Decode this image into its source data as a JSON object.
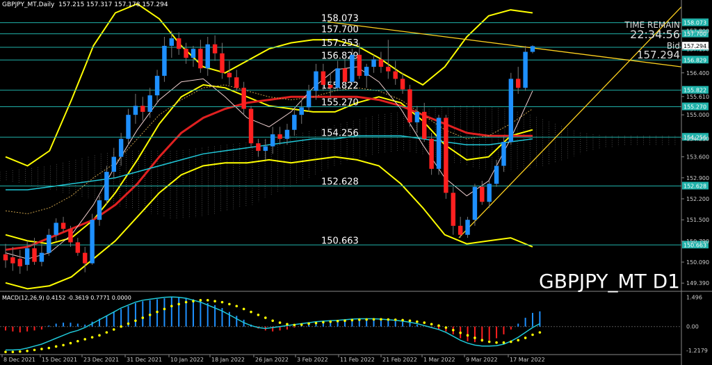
{
  "header": {
    "symbol_tf": "GBPJPY_MT,Daily",
    "ohlc": "157.215 157.317 157.178 157.294"
  },
  "watermark": "GBPJPY_MT D1",
  "info_box": {
    "time_remain_label": "TIME REMAIN",
    "time_remain_value": "22:34:56",
    "bid_label": "Bid",
    "bid_value": "157.294"
  },
  "macd_label": "MACD(12,26,9) 0.4152 -0.3619 0.7771 0.0000",
  "colors": {
    "bg": "#000000",
    "bull": "#1e90ff",
    "bear": "#ff2020",
    "level_line": "#20b2aa",
    "yellow": "#ffff00",
    "red_ma": "#e02020",
    "cyan_ma": "#20c8d8",
    "pink_ma": "#f0d0d0",
    "trend": "#ffd21f"
  },
  "chart_data": {
    "type": "candlestick",
    "title": "GBPJPY_MT D1",
    "ylim": [
      149.14,
      158.55
    ],
    "y_ticks": [
      "157.800",
      "157.190",
      "156.400",
      "155.610",
      "155.000",
      "154.210",
      "153.600",
      "152.900",
      "152.200",
      "151.500",
      "150.790",
      "150.090",
      "149.390"
    ],
    "x_labels": [
      "8 Dec 2021",
      "15 Dec 2021",
      "23 Dec 2021",
      "31 Dec 2021",
      "10 Jan 2022",
      "18 Jan 2022",
      "26 Jan 2022",
      "3 Feb 2022",
      "11 Feb 2022",
      "21 Feb 2022",
      "1 Mar 2022",
      "9 Mar 2022",
      "17 Mar 2022"
    ],
    "levels": [
      {
        "value": 158.073,
        "label": "158.073",
        "tag": "158.073"
      },
      {
        "value": 157.7,
        "label": "157.700",
        "tag": "157.700"
      },
      {
        "value": 157.253,
        "label": "157.253",
        "tag": "157.253"
      },
      {
        "value": 156.829,
        "label": "156.829",
        "tag": "156.829"
      },
      {
        "value": 155.822,
        "label": "155.822",
        "tag": "155.822"
      },
      {
        "value": 155.27,
        "label": "155.270",
        "tag": "155.270"
      },
      {
        "value": 154.256,
        "label": "154.256",
        "tag": "154.256"
      },
      {
        "value": 152.628,
        "label": "152.628",
        "tag": "152.628"
      },
      {
        "value": 150.663,
        "label": "150.663",
        "tag": "150.663"
      }
    ],
    "current_price": {
      "value": 157.294,
      "tag": "157.294"
    },
    "candles": [
      {
        "o": 150.35,
        "h": 150.7,
        "l": 149.9,
        "c": 150.15
      },
      {
        "o": 150.25,
        "h": 150.6,
        "l": 149.8,
        "c": 150.05
      },
      {
        "o": 150.2,
        "h": 150.5,
        "l": 149.7,
        "c": 149.95
      },
      {
        "o": 150.0,
        "h": 150.8,
        "l": 149.8,
        "c": 150.55
      },
      {
        "o": 150.55,
        "h": 150.9,
        "l": 150.0,
        "c": 150.1
      },
      {
        "o": 150.1,
        "h": 150.7,
        "l": 149.95,
        "c": 150.4
      },
      {
        "o": 150.4,
        "h": 151.2,
        "l": 150.3,
        "c": 151.0
      },
      {
        "o": 151.0,
        "h": 151.55,
        "l": 150.8,
        "c": 151.4
      },
      {
        "o": 151.4,
        "h": 151.6,
        "l": 151.1,
        "c": 151.2
      },
      {
        "o": 151.2,
        "h": 151.3,
        "l": 150.6,
        "c": 150.75
      },
      {
        "o": 150.75,
        "h": 150.9,
        "l": 150.3,
        "c": 150.4
      },
      {
        "o": 150.4,
        "h": 150.6,
        "l": 149.75,
        "c": 150.05
      },
      {
        "o": 150.05,
        "h": 151.7,
        "l": 150.0,
        "c": 151.5
      },
      {
        "o": 151.5,
        "h": 152.3,
        "l": 151.3,
        "c": 152.15
      },
      {
        "o": 152.15,
        "h": 153.3,
        "l": 152.0,
        "c": 153.1
      },
      {
        "o": 153.1,
        "h": 153.9,
        "l": 152.9,
        "c": 153.6
      },
      {
        "o": 153.6,
        "h": 154.4,
        "l": 153.3,
        "c": 154.2
      },
      {
        "o": 154.2,
        "h": 155.2,
        "l": 154.0,
        "c": 155.0
      },
      {
        "o": 155.0,
        "h": 155.7,
        "l": 154.7,
        "c": 155.3
      },
      {
        "o": 155.3,
        "h": 155.6,
        "l": 154.8,
        "c": 155.1
      },
      {
        "o": 155.1,
        "h": 155.9,
        "l": 154.9,
        "c": 155.65
      },
      {
        "o": 155.65,
        "h": 156.5,
        "l": 155.4,
        "c": 156.3
      },
      {
        "o": 156.3,
        "h": 157.6,
        "l": 156.1,
        "c": 157.3
      },
      {
        "o": 157.3,
        "h": 157.8,
        "l": 156.9,
        "c": 157.55
      },
      {
        "o": 157.55,
        "h": 157.75,
        "l": 157.0,
        "c": 157.2
      },
      {
        "o": 157.2,
        "h": 157.4,
        "l": 156.7,
        "c": 156.9
      },
      {
        "o": 156.9,
        "h": 157.3,
        "l": 156.6,
        "c": 157.2
      },
      {
        "o": 157.2,
        "h": 157.5,
        "l": 156.4,
        "c": 156.55
      },
      {
        "o": 156.55,
        "h": 157.6,
        "l": 156.3,
        "c": 157.35
      },
      {
        "o": 157.35,
        "h": 157.65,
        "l": 156.8,
        "c": 157.05
      },
      {
        "o": 157.05,
        "h": 157.4,
        "l": 156.2,
        "c": 156.4
      },
      {
        "o": 156.4,
        "h": 156.8,
        "l": 156.0,
        "c": 156.25
      },
      {
        "o": 156.25,
        "h": 156.5,
        "l": 155.8,
        "c": 155.9
      },
      {
        "o": 155.9,
        "h": 156.1,
        "l": 155.0,
        "c": 155.2
      },
      {
        "o": 155.2,
        "h": 155.3,
        "l": 153.9,
        "c": 154.05
      },
      {
        "o": 154.05,
        "h": 154.2,
        "l": 153.6,
        "c": 153.8
      },
      {
        "o": 153.8,
        "h": 154.2,
        "l": 153.5,
        "c": 153.95
      },
      {
        "o": 153.95,
        "h": 154.6,
        "l": 153.7,
        "c": 154.35
      },
      {
        "o": 154.35,
        "h": 154.6,
        "l": 154.0,
        "c": 154.2
      },
      {
        "o": 154.2,
        "h": 154.7,
        "l": 154.0,
        "c": 154.5
      },
      {
        "o": 154.5,
        "h": 155.2,
        "l": 154.3,
        "c": 155.0
      },
      {
        "o": 155.0,
        "h": 155.5,
        "l": 154.7,
        "c": 155.25
      },
      {
        "o": 155.25,
        "h": 156.0,
        "l": 155.1,
        "c": 155.8
      },
      {
        "o": 155.8,
        "h": 156.7,
        "l": 155.5,
        "c": 156.45
      },
      {
        "o": 156.45,
        "h": 156.7,
        "l": 155.8,
        "c": 156.0
      },
      {
        "o": 156.0,
        "h": 156.4,
        "l": 155.6,
        "c": 155.9
      },
      {
        "o": 155.9,
        "h": 156.8,
        "l": 155.8,
        "c": 156.55
      },
      {
        "o": 156.55,
        "h": 156.9,
        "l": 155.9,
        "c": 156.1
      },
      {
        "o": 156.1,
        "h": 157.2,
        "l": 156.0,
        "c": 157.0
      },
      {
        "o": 157.0,
        "h": 157.4,
        "l": 156.2,
        "c": 156.3
      },
      {
        "o": 156.3,
        "h": 156.7,
        "l": 155.9,
        "c": 156.6
      },
      {
        "o": 156.6,
        "h": 157.0,
        "l": 156.4,
        "c": 156.85
      },
      {
        "o": 156.85,
        "h": 157.1,
        "l": 156.4,
        "c": 156.6
      },
      {
        "o": 156.6,
        "h": 157.5,
        "l": 156.2,
        "c": 156.45
      },
      {
        "o": 156.45,
        "h": 156.8,
        "l": 156.0,
        "c": 156.2
      },
      {
        "o": 156.2,
        "h": 156.4,
        "l": 155.7,
        "c": 155.85
      },
      {
        "o": 155.85,
        "h": 156.0,
        "l": 154.6,
        "c": 154.75
      },
      {
        "o": 154.75,
        "h": 155.3,
        "l": 154.4,
        "c": 155.1
      },
      {
        "o": 155.1,
        "h": 155.4,
        "l": 154.1,
        "c": 154.2
      },
      {
        "o": 154.2,
        "h": 154.4,
        "l": 153.0,
        "c": 153.2
      },
      {
        "o": 153.2,
        "h": 155.0,
        "l": 153.0,
        "c": 154.9
      },
      {
        "o": 154.9,
        "h": 155.0,
        "l": 152.2,
        "c": 152.4
      },
      {
        "o": 152.4,
        "h": 152.6,
        "l": 151.0,
        "c": 151.3
      },
      {
        "o": 151.3,
        "h": 151.6,
        "l": 150.9,
        "c": 151.0
      },
      {
        "o": 151.0,
        "h": 151.6,
        "l": 150.9,
        "c": 151.5
      },
      {
        "o": 151.5,
        "h": 152.7,
        "l": 151.3,
        "c": 152.6
      },
      {
        "o": 152.6,
        "h": 152.8,
        "l": 152.0,
        "c": 152.1
      },
      {
        "o": 152.1,
        "h": 152.8,
        "l": 151.9,
        "c": 152.7
      },
      {
        "o": 152.7,
        "h": 153.5,
        "l": 152.6,
        "c": 153.3
      },
      {
        "o": 153.3,
        "h": 154.3,
        "l": 153.1,
        "c": 154.1
      },
      {
        "o": 154.1,
        "h": 156.4,
        "l": 154.0,
        "c": 156.2
      },
      {
        "o": 156.2,
        "h": 156.6,
        "l": 155.7,
        "c": 155.9
      },
      {
        "o": 155.9,
        "h": 157.3,
        "l": 155.8,
        "c": 157.1
      },
      {
        "o": 157.1,
        "h": 157.32,
        "l": 157.05,
        "c": 157.29
      }
    ],
    "macd": {
      "ylim": [
        -1.4,
        1.7
      ],
      "ticks": [
        "1.496",
        "0.00",
        "-1.2179"
      ],
      "histogram": [
        -0.2,
        -0.25,
        -0.3,
        -0.25,
        -0.2,
        -0.15,
        0.05,
        0.15,
        0.2,
        0.2,
        0.15,
        0.1,
        0.25,
        0.4,
        0.55,
        0.75,
        0.9,
        1.05,
        1.2,
        1.3,
        1.35,
        1.4,
        1.45,
        1.5,
        1.5,
        1.45,
        1.4,
        1.3,
        1.2,
        1.1,
        0.95,
        0.75,
        0.55,
        0.35,
        0.1,
        -0.1,
        -0.2,
        -0.25,
        -0.2,
        -0.15,
        -0.05,
        0.05,
        0.15,
        0.2,
        0.22,
        0.25,
        0.3,
        0.32,
        0.35,
        0.35,
        0.35,
        0.33,
        0.3,
        0.3,
        0.28,
        0.25,
        0.2,
        0.1,
        0.0,
        -0.05,
        -0.15,
        -0.25,
        -0.4,
        -0.6,
        -0.75,
        -0.8,
        -0.78,
        -0.7,
        -0.6,
        -0.4,
        -0.15,
        0.15,
        0.45,
        0.7,
        0.78
      ],
      "macd_line": [
        -1.2,
        -1.2,
        -1.18,
        -1.1,
        -1.0,
        -0.9,
        -0.75,
        -0.6,
        -0.45,
        -0.3,
        -0.2,
        -0.05,
        0.15,
        0.35,
        0.55,
        0.75,
        0.95,
        1.1,
        1.25,
        1.35,
        1.4,
        1.45,
        1.5,
        1.52,
        1.5,
        1.45,
        1.35,
        1.25,
        1.1,
        0.95,
        0.8,
        0.6,
        0.4,
        0.2,
        0.05,
        -0.05,
        -0.1,
        -0.05,
        0.0,
        0.05,
        0.1,
        0.15,
        0.2,
        0.25,
        0.28,
        0.3,
        0.32,
        0.35,
        0.38,
        0.4,
        0.4,
        0.4,
        0.38,
        0.35,
        0.32,
        0.28,
        0.22,
        0.15,
        0.05,
        -0.05,
        -0.15,
        -0.3,
        -0.5,
        -0.7,
        -0.85,
        -0.95,
        -1.0,
        -1.0,
        -0.98,
        -0.9,
        -0.75,
        -0.55,
        -0.3,
        -0.05,
        0.15
      ],
      "signal_line": [
        -1.3,
        -1.3,
        -1.28,
        -1.25,
        -1.2,
        -1.15,
        -1.1,
        -1.02,
        -0.95,
        -0.85,
        -0.75,
        -0.65,
        -0.55,
        -0.45,
        -0.3,
        -0.15,
        0.0,
        0.15,
        0.3,
        0.45,
        0.6,
        0.75,
        0.9,
        1.05,
        1.15,
        1.25,
        1.3,
        1.35,
        1.35,
        1.3,
        1.25,
        1.15,
        1.05,
        0.9,
        0.75,
        0.6,
        0.45,
        0.3,
        0.2,
        0.12,
        0.08,
        0.1,
        0.15,
        0.18,
        0.22,
        0.25,
        0.28,
        0.3,
        0.33,
        0.35,
        0.36,
        0.37,
        0.37,
        0.36,
        0.35,
        0.33,
        0.3,
        0.25,
        0.2,
        0.12,
        0.05,
        -0.05,
        -0.18,
        -0.32,
        -0.45,
        -0.58,
        -0.7,
        -0.78,
        -0.82,
        -0.82,
        -0.78,
        -0.7,
        -0.58,
        -0.42,
        -0.3
      ]
    }
  }
}
